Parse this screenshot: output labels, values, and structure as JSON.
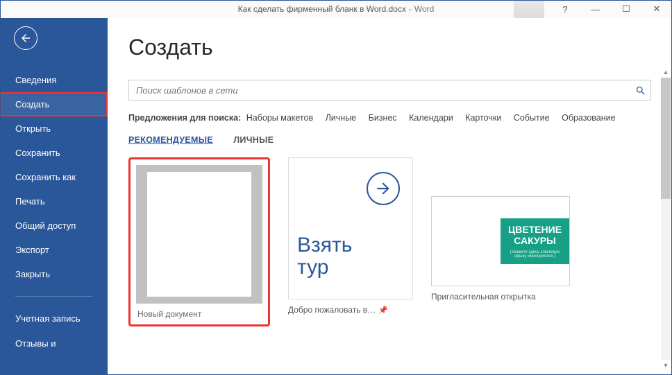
{
  "window": {
    "doc_name": "Как сделать фирменный бланк в Word.docx",
    "sep": "  -  ",
    "app": "Word",
    "help_char": "?",
    "min_char": "—",
    "max_char": "☐",
    "close_char": "✕"
  },
  "sidebar": [
    {
      "label": "Сведения",
      "selected": false
    },
    {
      "label": "Создать",
      "selected": true
    },
    {
      "label": "Открыть",
      "selected": false
    },
    {
      "label": "Сохранить",
      "selected": false
    },
    {
      "label": "Сохранить как",
      "selected": false
    },
    {
      "label": "Печать",
      "selected": false
    },
    {
      "label": "Общий доступ",
      "selected": false
    },
    {
      "label": "Экспорт",
      "selected": false
    },
    {
      "label": "Закрыть",
      "selected": false
    }
  ],
  "sidebar2": [
    {
      "label": "Учетная запись"
    },
    {
      "label": "Отзывы и"
    }
  ],
  "page": {
    "title": "Создать"
  },
  "search": {
    "placeholder": "Поиск шаблонов в сети"
  },
  "suggestions": {
    "label": "Предложения для поиска:",
    "items": [
      "Наборы макетов",
      "Личные",
      "Бизнес",
      "Календари",
      "Карточки",
      "Событие",
      "Образование"
    ]
  },
  "tabs": {
    "recommended": "РЕКОМЕНДУЕМЫЕ",
    "personal": "ЛИЧНЫЕ"
  },
  "templates": {
    "blank": {
      "label": "Новый документ"
    },
    "tour": {
      "label": "Добро пожаловать в…",
      "line1": "Взять",
      "line2": "тур"
    },
    "invite": {
      "label": "Пригласительная открытка",
      "title": "ЦВЕТЕНИЕ САКУРЫ",
      "sub": "(Укажите здесь ключевую фразу мероприятия.)"
    }
  }
}
